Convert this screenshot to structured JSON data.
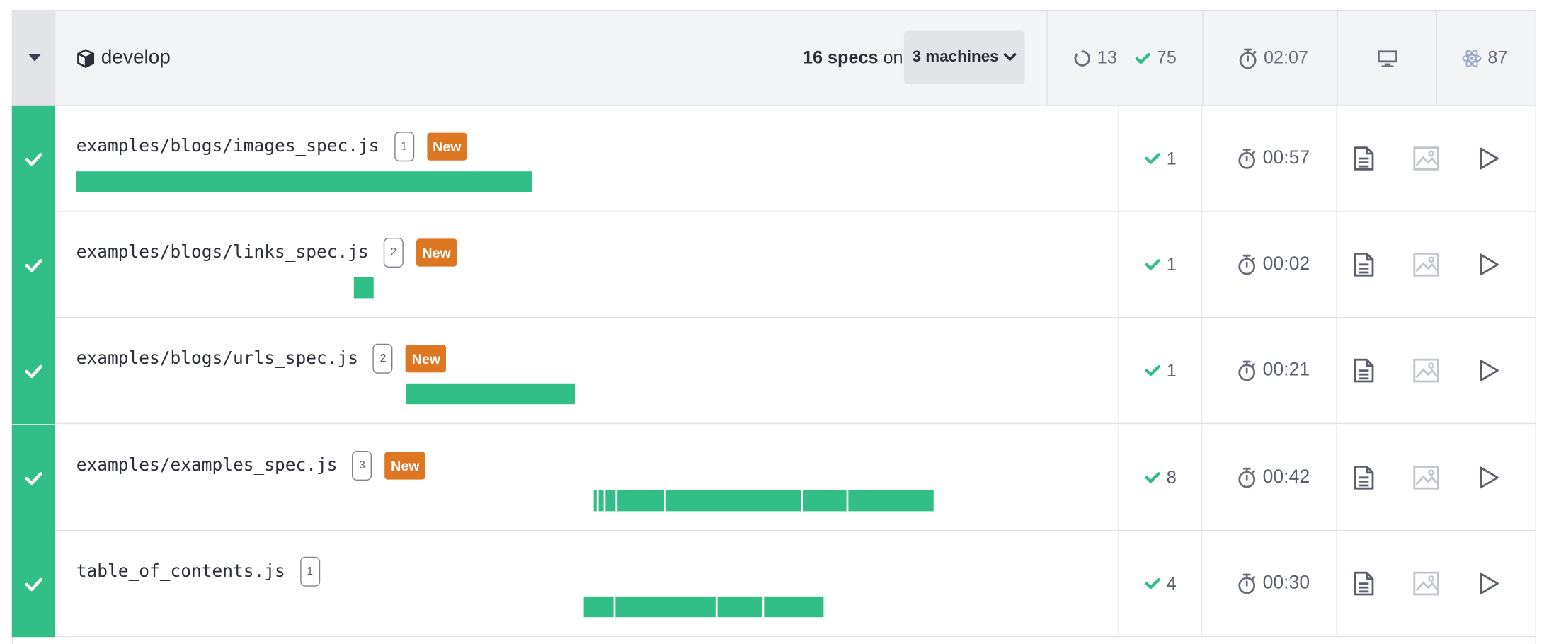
{
  "header": {
    "branch": "develop",
    "specs_count": "16 specs",
    "specs_on": "on",
    "machines_label": "3 machines",
    "pending_count": "13",
    "passed_count": "75",
    "duration": "02:07",
    "electron_count": "87"
  },
  "colors": {
    "pass_green": "#31be87",
    "new_badge_orange": "#dd7722",
    "header_bg": "#f3f4f6"
  },
  "icons": [
    "chevron-down-icon",
    "package-icon",
    "refresh-icon",
    "check-icon",
    "stopwatch-icon",
    "desktop-icon",
    "electron-icon",
    "document-icon",
    "image-icon",
    "play-icon"
  ],
  "specs": [
    {
      "name": "examples/blogs/images_spec.js",
      "group": "1",
      "badge": "New",
      "passed": "1",
      "duration": "00:57"
    },
    {
      "name": "examples/blogs/links_spec.js",
      "group": "2",
      "badge": "New",
      "passed": "1",
      "duration": "00:02"
    },
    {
      "name": "examples/blogs/urls_spec.js",
      "group": "2",
      "badge": "New",
      "passed": "1",
      "duration": "00:21"
    },
    {
      "name": "examples/examples_spec.js",
      "group": "3",
      "badge": "New",
      "passed": "8",
      "duration": "00:42"
    },
    {
      "name": "table_of_contents.js",
      "group": "1",
      "badge": "",
      "passed": "4",
      "duration": "00:30"
    }
  ]
}
